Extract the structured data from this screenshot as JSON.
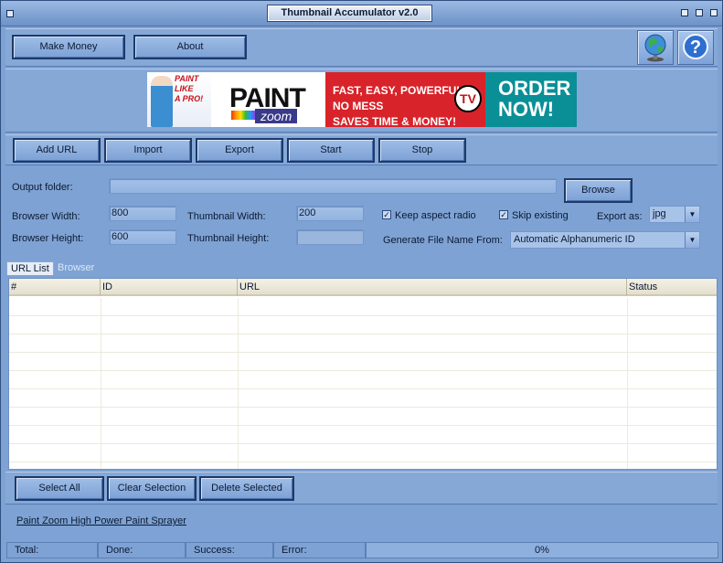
{
  "window": {
    "title": "Thumbnail Accumulator v2.0"
  },
  "top_buttons": {
    "make_money": "Make Money",
    "about": "About"
  },
  "banner": {
    "line1": "PAINT LIKE",
    "line2": "A PRO!",
    "brand": "PAINT",
    "brand_sub": "zoom",
    "tagline1": "FAST, EASY, POWERFUL, NO MESS",
    "tagline2": "SAVES TIME & MONEY!",
    "tv_badge": "TV",
    "cta1": "ORDER",
    "cta2": "NOW!"
  },
  "actions": {
    "add_url": "Add URL",
    "import": "Import",
    "export": "Export",
    "start": "Start",
    "stop": "Stop"
  },
  "form": {
    "output_folder_label": "Output folder:",
    "output_folder_value": "",
    "browse": "Browse",
    "browser_width_label": "Browser Width:",
    "browser_width_value": "800",
    "browser_height_label": "Browser Height:",
    "browser_height_value": "600",
    "thumb_width_label": "Thumbnail Width:",
    "thumb_width_value": "200",
    "thumb_height_label": "Thumbnail Height:",
    "thumb_height_value": "",
    "keep_aspect_label": "Keep aspect radio",
    "keep_aspect_checked": true,
    "skip_existing_label": "Skip existing",
    "skip_existing_checked": true,
    "export_as_label": "Export as:",
    "export_as_value": "jpg",
    "generate_name_label": "Generate File Name From:",
    "generate_name_value": "Automatic Alphanumeric ID"
  },
  "tabs": [
    {
      "label": "URL List",
      "active": true
    },
    {
      "label": "Browser",
      "active": false
    }
  ],
  "table": {
    "columns": [
      "#",
      "ID",
      "URL",
      "Status"
    ],
    "rows": []
  },
  "selection": {
    "select_all": "Select All",
    "clear_selection": "Clear Selection",
    "delete_selected": "Delete Selected"
  },
  "ad_link": "Paint Zoom High Power Paint Sprayer",
  "statusbar": {
    "total": "Total:",
    "done": "Done:",
    "success": "Success:",
    "error": "Error:",
    "progress": "0%"
  },
  "icons": {
    "globe": "globe-icon",
    "help": "help-icon"
  }
}
